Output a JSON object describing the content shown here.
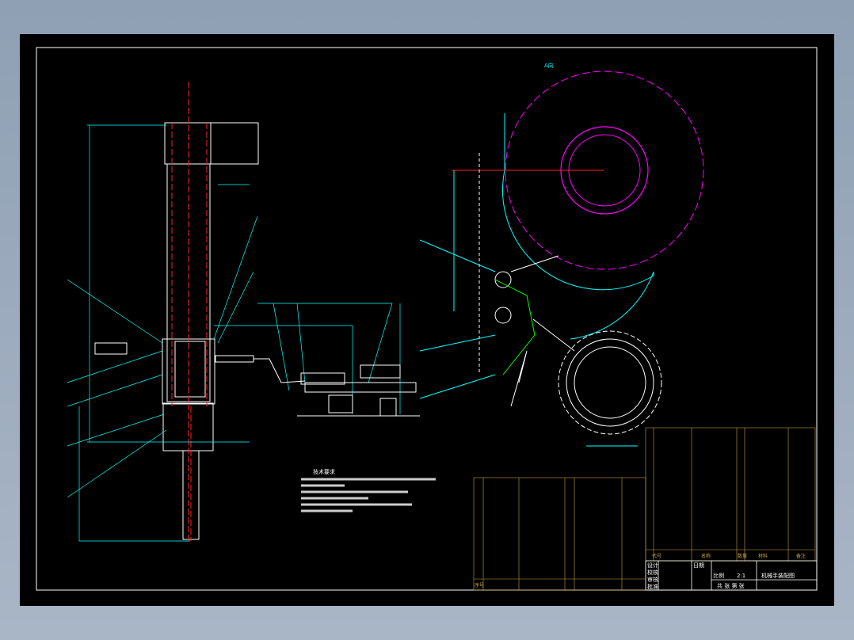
{
  "title_block": {
    "drawing_title": "机械手装配图",
    "scale_label": "比例",
    "scale_value": "2:1",
    "sheet_text": "共 张 第 张",
    "designer": "设计",
    "checker": "校核",
    "reviewer": "审核",
    "approver": "批准",
    "date": "日期"
  },
  "bom_headers": {
    "seq": "序号",
    "code": "代号",
    "name": "名称",
    "qty": "数量",
    "material": "材料",
    "note": "备注"
  },
  "view_label": "A向",
  "notes_title": "技术要求",
  "colors": {
    "background": "#000000",
    "frame": "#ffffff",
    "center_lines": "#ff2020",
    "dimensions": "#00ffff",
    "hidden": "#ff00ff",
    "table_lines": "#c8a040",
    "parts": "#ffffff",
    "highlight": "#00ff00"
  }
}
